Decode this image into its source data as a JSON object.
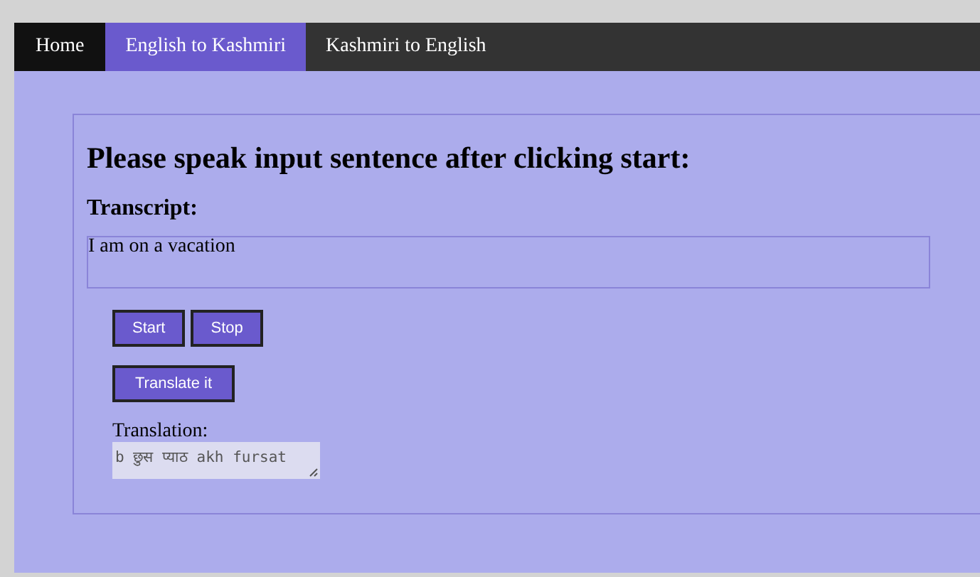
{
  "nav": {
    "tabs": [
      {
        "label": "Home",
        "kind": "brand",
        "selected": false
      },
      {
        "label": "English to Kashmiri",
        "kind": "link",
        "selected": true
      },
      {
        "label": "Kashmiri to English",
        "kind": "link",
        "selected": false
      }
    ]
  },
  "panel": {
    "heading": "Please speak input sentence after clicking start:",
    "transcript_label": "Transcript:",
    "transcript": "I am on a vacation",
    "buttons": [
      {
        "label": "Start"
      },
      {
        "label": "Stop"
      }
    ],
    "translate_button": "Translate it",
    "translation_label": "Translation:",
    "translation": "b छुस प्याठ akh fursat"
  }
}
